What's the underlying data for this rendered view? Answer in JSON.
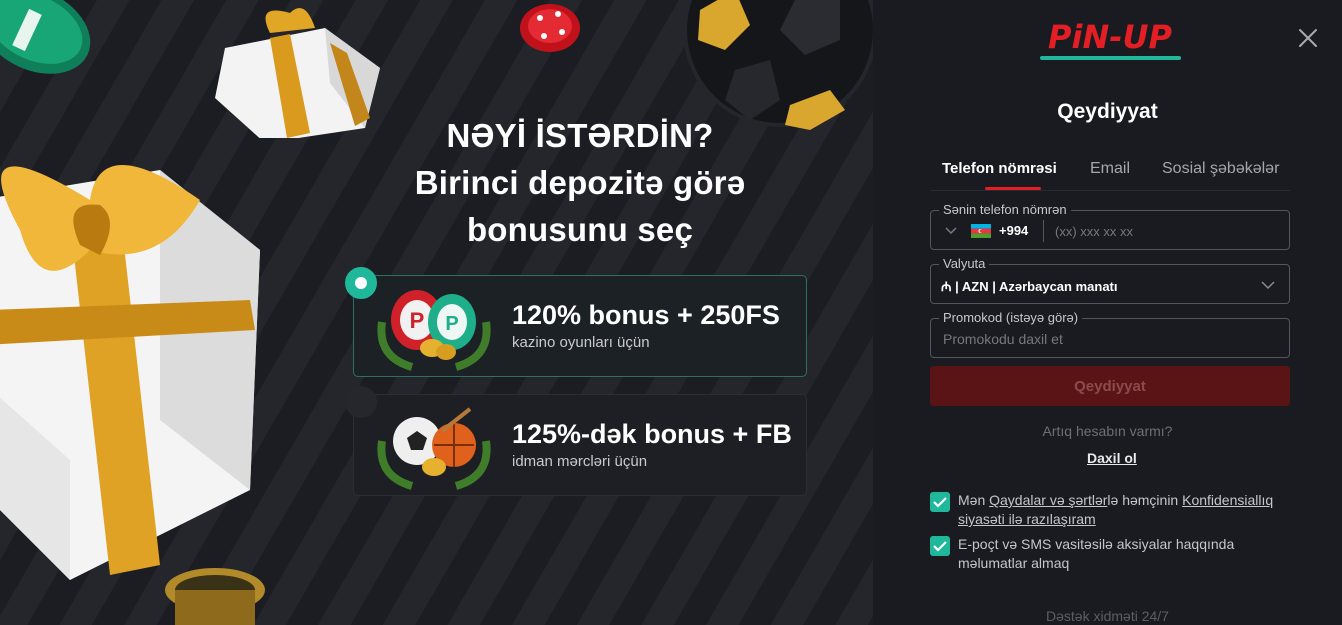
{
  "promo": {
    "headline_line1": "NƏYİ İSTƏRDİN?",
    "headline_line2": "Birinci depozitə görə",
    "headline_line3": "bonusunu seç",
    "offers": [
      {
        "title": "120% bonus + 250FS",
        "subtitle": "kazino oyunları üçün",
        "selected": true
      },
      {
        "title": "125%-dək bonus + FB",
        "subtitle": "idman mərcləri üçün",
        "selected": false
      }
    ]
  },
  "panel": {
    "logo_text": "PiN-UP",
    "title": "Qeydiyyat",
    "tabs": [
      "Telefon nömrəsi",
      "Email",
      "Sosial şəbəkələr"
    ],
    "active_tab": 0,
    "phone": {
      "label": "Sənin telefon nömrən",
      "country_code": "+994",
      "placeholder": "(xx) xxx xx xx"
    },
    "currency": {
      "label": "Valyuta",
      "value": "₼ | AZN | Azərbaycan manatı"
    },
    "promocode": {
      "label": "Promokod (istəyə görə)",
      "placeholder": "Promokodu daxil et"
    },
    "submit_label": "Qeydiyyat",
    "have_account": "Artıq hesabın varmı?",
    "login_label": "Daxil ol",
    "consent1": {
      "prefix": "Mən ",
      "link1": "Qaydalar və şərtlər",
      "middle": "lə həmçinin ",
      "link2": "Konfidensiallıq siyasəti ilə razılaşıram",
      "checked": true
    },
    "consent2": {
      "text": "E-poçt və SMS vasitəsilə aksiyalar haqqında məlumatlar almaq",
      "checked": true
    },
    "support": "Dəstək xidməti 24/7"
  },
  "colors": {
    "brand_red": "#e31e24",
    "accent_teal": "#1fb89b",
    "panel_bg": "#1a1b20"
  },
  "icons": [
    "close-icon",
    "chevron-down-icon",
    "azerbaijan-flag-icon",
    "checkmark-icon"
  ]
}
